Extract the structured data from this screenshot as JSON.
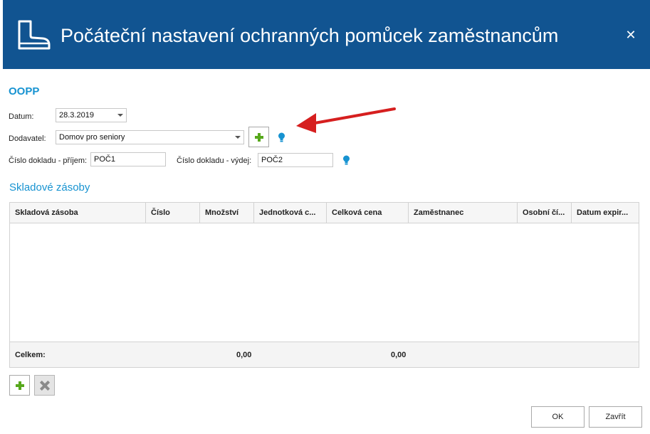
{
  "window": {
    "title": "Počáteční nastavení ochranných pomůcek zaměstnancům",
    "close_glyph": "✕",
    "icon": "boot-icon",
    "header_color": "#115491"
  },
  "form": {
    "section_title": "OOPP",
    "date_label": "Datum:",
    "date_value": "28.3.2019",
    "supplier_label": "Dodavatel:",
    "supplier_value": "Domov pro seniory",
    "receipt_label": "Číslo dokladu - příjem:",
    "receipt_value": "POČ1",
    "issue_label": "Číslo dokladu - výdej:",
    "issue_value": "POČ2",
    "accent_color": "#1793d1"
  },
  "stock": {
    "title": "Skladové zásoby",
    "columns": [
      "Skladová zásoba",
      "Číslo",
      "Množství",
      "Jednotková c...",
      "Celková cena",
      "Zaměstnanec",
      "Osobní čí...",
      "Datum expir..."
    ],
    "footer": {
      "label": "Celkem:",
      "quantity_total": "0,00",
      "price_total": "0,00"
    }
  },
  "buttons": {
    "ok": "OK",
    "close": "Zavřít"
  }
}
